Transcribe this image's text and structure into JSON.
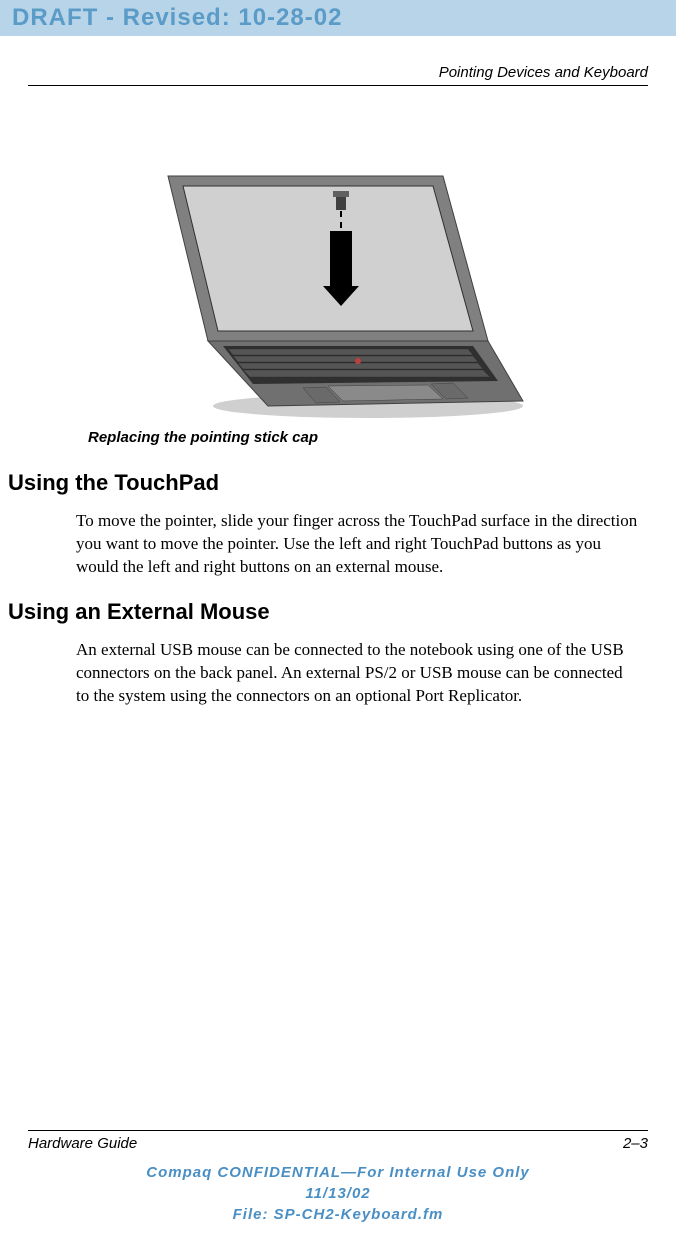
{
  "draft_banner": "DRAFT - Revised: 10-28-02",
  "header": {
    "chapter_title": "Pointing Devices and Keyboard"
  },
  "figure": {
    "caption": "Replacing the pointing stick cap"
  },
  "sections": [
    {
      "heading": "Using the TouchPad",
      "body": "To move the pointer, slide your finger across the TouchPad surface in the direction you want to move the pointer. Use the left and right TouchPad buttons as you would the left and right buttons on an external mouse."
    },
    {
      "heading": "Using an External Mouse",
      "body": "An external USB mouse can be connected to the notebook using one of the USB connectors on the back panel. An external PS/2 or USB mouse can be connected to the system using the connectors on an optional Port Replicator."
    }
  ],
  "footer": {
    "guide_name": "Hardware Guide",
    "page_number": "2–3",
    "confidential_line1": "Compaq CONFIDENTIAL—For Internal Use Only",
    "confidential_line2": "11/13/02",
    "confidential_line3": "File: SP-CH2-Keyboard.fm"
  }
}
